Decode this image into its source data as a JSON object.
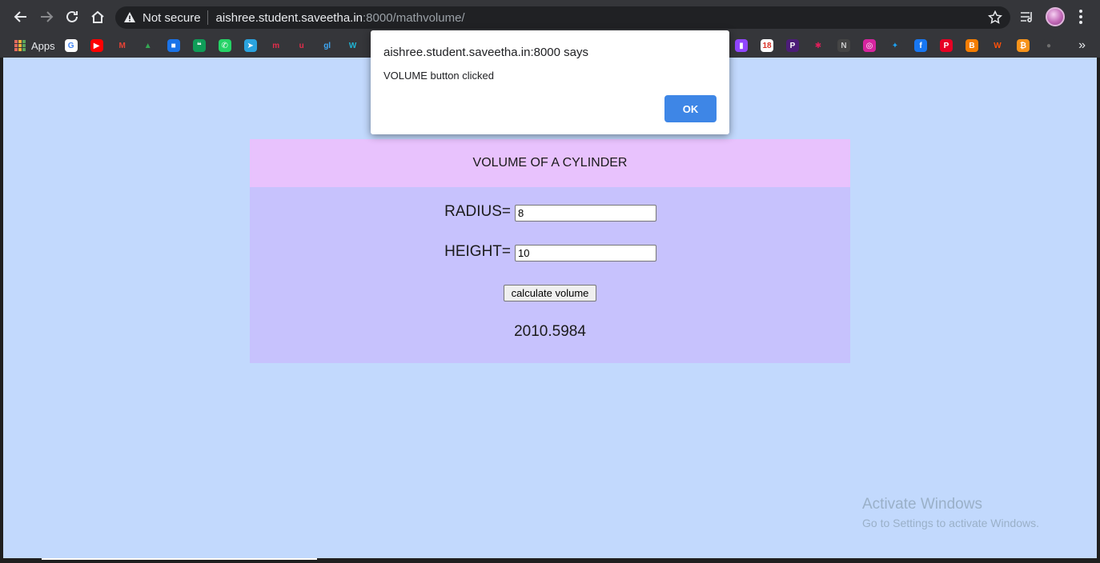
{
  "browser": {
    "not_secure_label": "Not secure",
    "url_host": "aishree.student.saveetha.in",
    "url_rest": ":8000/mathvolume/"
  },
  "bookmarks": {
    "apps_label": "Apps",
    "icons": [
      {
        "name": "google-icon",
        "glyph": "G",
        "color": "#ffffff",
        "fg": "#4285f4"
      },
      {
        "name": "youtube-icon",
        "glyph": "▶",
        "color": "#ff0000",
        "fg": "#ffffff"
      },
      {
        "name": "gmail-icon",
        "glyph": "M",
        "color": "#35363a",
        "fg": "#ea4335"
      },
      {
        "name": "google-drive-icon",
        "glyph": "▲",
        "color": "#35363a",
        "fg": "#34a853"
      },
      {
        "name": "google-meet-icon",
        "glyph": "■",
        "color": "#1a73e8",
        "fg": "#ffffff"
      },
      {
        "name": "hangouts-icon",
        "glyph": "❝",
        "color": "#0f9d58",
        "fg": "#ffffff"
      },
      {
        "name": "whatsapp-icon",
        "glyph": "✆",
        "color": "#25d366",
        "fg": "#ffffff"
      },
      {
        "name": "telegram-icon",
        "glyph": "➤",
        "color": "#2aa3df",
        "fg": "#ffffff"
      },
      {
        "name": "m-app-icon",
        "glyph": "m",
        "color": "#35363a",
        "fg": "#e52d4b"
      },
      {
        "name": "u-app-icon",
        "glyph": "u",
        "color": "#35363a",
        "fg": "#e52d4b"
      },
      {
        "name": "gl-app-icon",
        "glyph": "gl",
        "color": "#35363a",
        "fg": "#3ea8f5"
      },
      {
        "name": "w-app-icon",
        "glyph": "W",
        "color": "#35363a",
        "fg": "#1fb6d6"
      }
    ],
    "right_icons": [
      {
        "name": "twitch-icon",
        "glyph": "▮",
        "color": "#9146ff",
        "fg": "#ffffff"
      },
      {
        "name": "calendar-icon",
        "glyph": "18",
        "color": "#ffffff",
        "fg": "#d93025"
      },
      {
        "name": "p-app-icon",
        "glyph": "P",
        "color": "#4c1d78",
        "fg": "#ffffff"
      },
      {
        "name": "slack-icon",
        "glyph": "✱",
        "color": "#35363a",
        "fg": "#e01e5a"
      },
      {
        "name": "notion-icon",
        "glyph": "N",
        "color": "#444444",
        "fg": "#cccccc"
      },
      {
        "name": "instagram-icon",
        "glyph": "◎",
        "color": "#d6249f",
        "fg": "#ffffff"
      },
      {
        "name": "twitter-icon",
        "glyph": "✦",
        "color": "#35363a",
        "fg": "#1da1f2"
      },
      {
        "name": "facebook-icon",
        "glyph": "f",
        "color": "#1877f2",
        "fg": "#ffffff"
      },
      {
        "name": "pinterest-icon",
        "glyph": "P",
        "color": "#e60023",
        "fg": "#ffffff"
      },
      {
        "name": "blogger-icon",
        "glyph": "B",
        "color": "#f57d00",
        "fg": "#ffffff"
      },
      {
        "name": "wattpad-icon",
        "glyph": "W",
        "color": "#35363a",
        "fg": "#ff500a"
      },
      {
        "name": "bitcoin-icon",
        "glyph": "₿",
        "color": "#f7931a",
        "fg": "#ffffff"
      },
      {
        "name": "github-icon",
        "glyph": "●",
        "color": "#35363a",
        "fg": "#6e6e6e"
      }
    ],
    "more_label": "»"
  },
  "page": {
    "header_title": "VOLUME OF A CYLINDER",
    "radius_label": "RADIUS=",
    "radius_value": "8",
    "height_label": "HEIGHT=",
    "height_value": "10",
    "calculate_label": "calculate volume",
    "result": "2010.5984"
  },
  "watermark": {
    "title": "Activate Windows",
    "subtitle": "Go to Settings to activate Windows."
  },
  "dialog": {
    "title": "aishree.student.saveetha.in:8000 says",
    "message": "VOLUME button clicked",
    "ok_label": "OK"
  }
}
